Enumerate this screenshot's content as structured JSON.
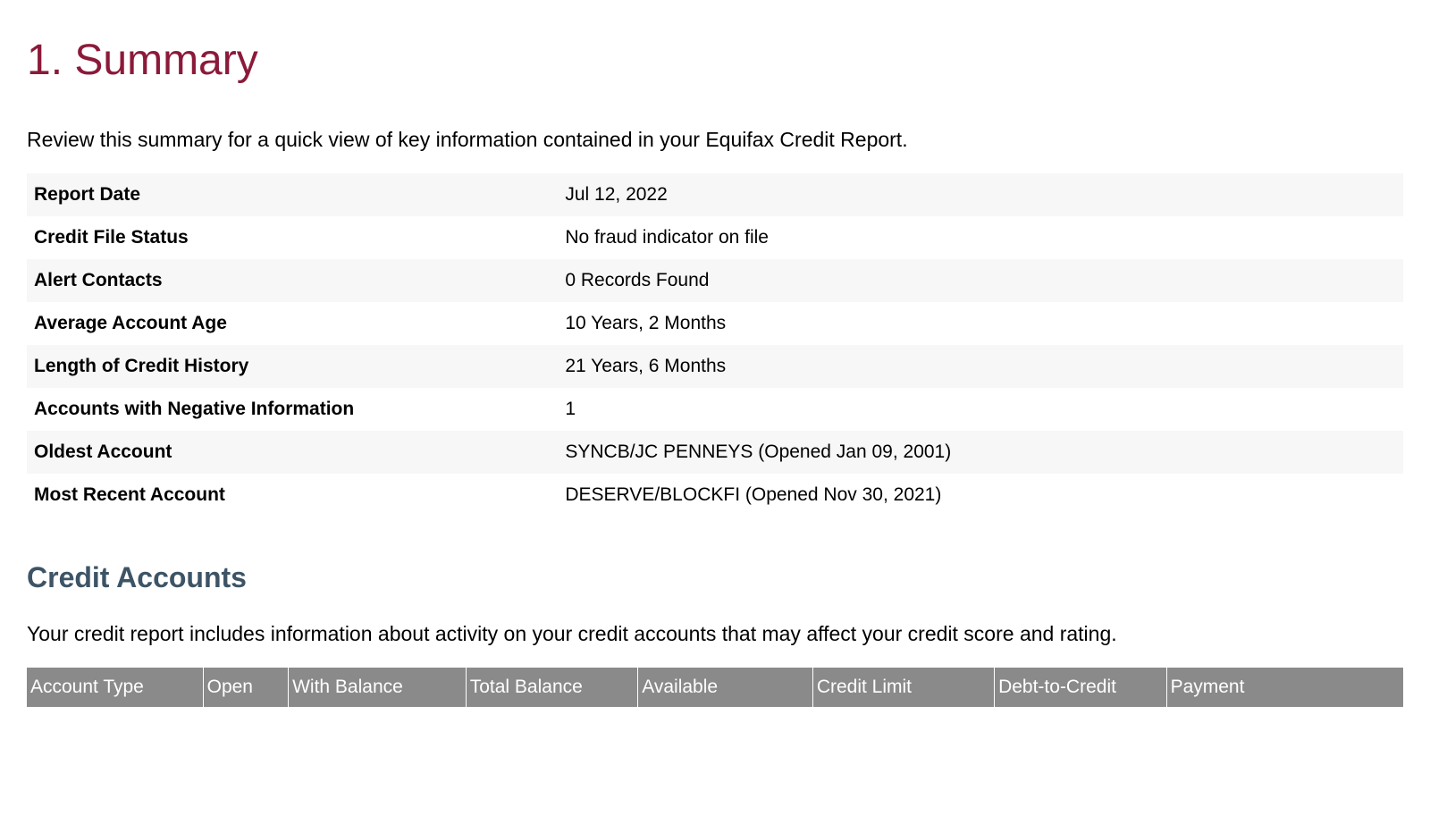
{
  "section": {
    "title": "1. Summary",
    "intro": "Review this summary for a quick view of key information contained in your Equifax Credit Report."
  },
  "summary_rows": [
    {
      "label": "Report Date",
      "value": "Jul 12, 2022"
    },
    {
      "label": "Credit File Status",
      "value": "No fraud indicator on file"
    },
    {
      "label": "Alert Contacts",
      "value": "0 Records Found"
    },
    {
      "label": "Average Account Age",
      "value": "10 Years, 2 Months"
    },
    {
      "label": "Length of Credit History",
      "value": "21 Years, 6 Months"
    },
    {
      "label": "Accounts with Negative Information",
      "value": "1"
    },
    {
      "label": "Oldest Account",
      "value": "SYNCB/JC PENNEYS (Opened Jan 09, 2001)"
    },
    {
      "label": "Most Recent Account",
      "value": "DESERVE/BLOCKFI (Opened Nov 30, 2021)"
    }
  ],
  "credit_accounts": {
    "title": "Credit Accounts",
    "intro": "Your credit report includes information about activity on your credit accounts that may affect your credit score and rating.",
    "headers": [
      "Account Type",
      "Open",
      "With Balance",
      "Total Balance",
      "Available",
      "Credit Limit",
      "Debt-to-Credit",
      "Payment"
    ]
  }
}
